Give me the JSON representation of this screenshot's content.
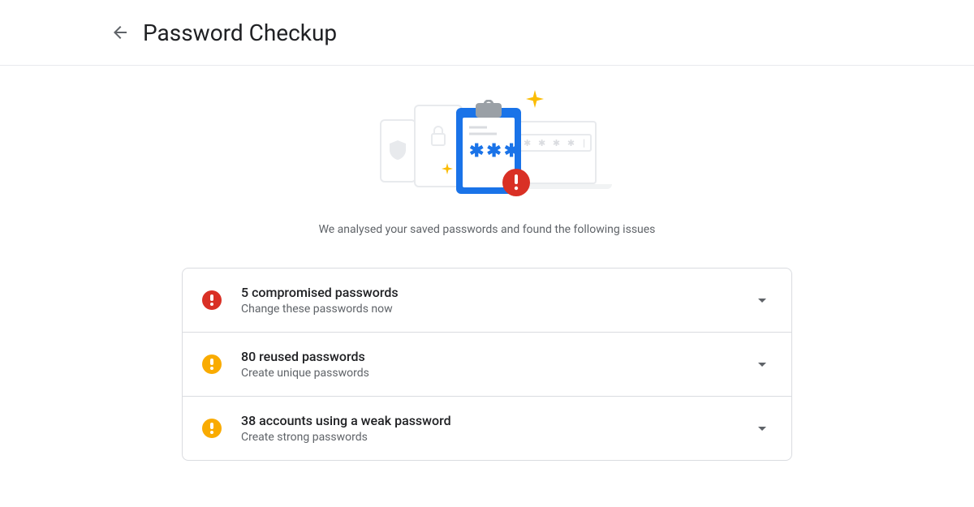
{
  "header": {
    "title": "Password Checkup"
  },
  "hero": {
    "subtitle": "We analysed your saved passwords and found the following issues"
  },
  "issues": [
    {
      "severity": "red",
      "title": "5 compromised passwords",
      "desc": "Change these passwords now"
    },
    {
      "severity": "yellow",
      "title": "80 reused passwords",
      "desc": "Create unique passwords"
    },
    {
      "severity": "yellow",
      "title": "38 accounts using a weak password",
      "desc": "Create strong passwords"
    }
  ],
  "colors": {
    "red": "#d93025",
    "yellow": "#f9ab00",
    "blue": "#1a73e8",
    "grey": "#5f6368"
  }
}
